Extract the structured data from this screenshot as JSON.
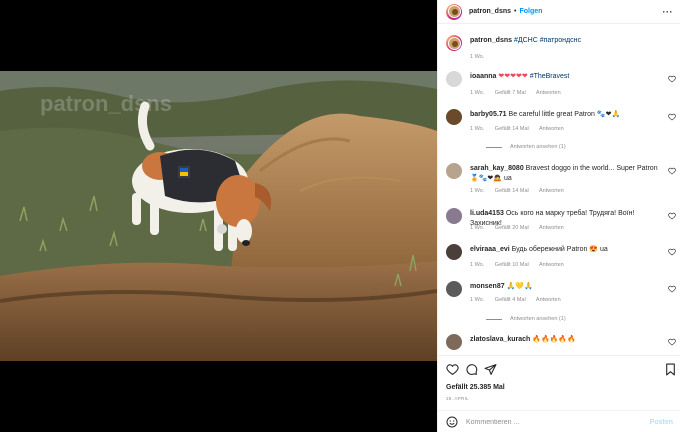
{
  "post": {
    "author": "patron_dsns",
    "follow_label": "Folgen",
    "more_label": "···",
    "caption_user": "patron_dsns",
    "caption_tags": "#ДСНС #патрондснс",
    "caption_time": "1 Wo."
  },
  "comments": [
    {
      "user": "ioaanna",
      "text": "❤❤❤❤❤",
      "tag": "#TheBravest",
      "time": "1 Wo.",
      "likes": "Gefällt 7 Mal",
      "reply": "Antworten"
    },
    {
      "user": "barby05.71",
      "text": "Be careful little great Patron 🐾❤🙏",
      "time": "1 Wo.",
      "likes": "Gefällt 14 Mal",
      "reply": "Antworten",
      "replies_label": "Antworten ansehen (1)"
    },
    {
      "user": "sarah_kay_8080",
      "text": "Bravest doggo in the world... Super Patron 🏅🐾❤🙇 ua",
      "time": "1 Wo.",
      "likes": "Gefällt 14 Mal",
      "reply": "Antworten"
    },
    {
      "user": "li.uda4153",
      "text": "Ось кого на марку треба! Трудяга! Воїн! Захисник!",
      "time": "1 Wo.",
      "likes": "Gefällt 20 Mal",
      "reply": "Antworten"
    },
    {
      "user": "elviraaa_evi",
      "text": "Будь обережний Patron 😍 ua",
      "time": "1 Wo.",
      "likes": "Gefällt 10 Mal",
      "reply": "Antworten"
    },
    {
      "user": "monsen87",
      "text": "🙏💛🙏",
      "time": "1 Wo.",
      "likes": "Gefällt 4 Mal",
      "reply": "Antworten",
      "replies_label": "Antworten ansehen (1)"
    },
    {
      "user": "zlatoslava_kurach",
      "text": "🔥🔥🔥🔥🔥"
    }
  ],
  "footer": {
    "likes": "Gefällt 25.385 Mal",
    "date": "28. APRIL",
    "comment_placeholder": "Kommentieren ...",
    "post_label": "Posten"
  },
  "icons": {
    "like": "heart-icon",
    "comment": "comment-icon",
    "share": "paper-plane-icon",
    "save": "bookmark-icon",
    "emoji": "smiley-icon",
    "more": "more-dots-icon"
  },
  "colors": {
    "accent": "#0095f6",
    "hashtag": "#00376b",
    "meta": "#8e8e8e",
    "heart": "#ed4956"
  }
}
